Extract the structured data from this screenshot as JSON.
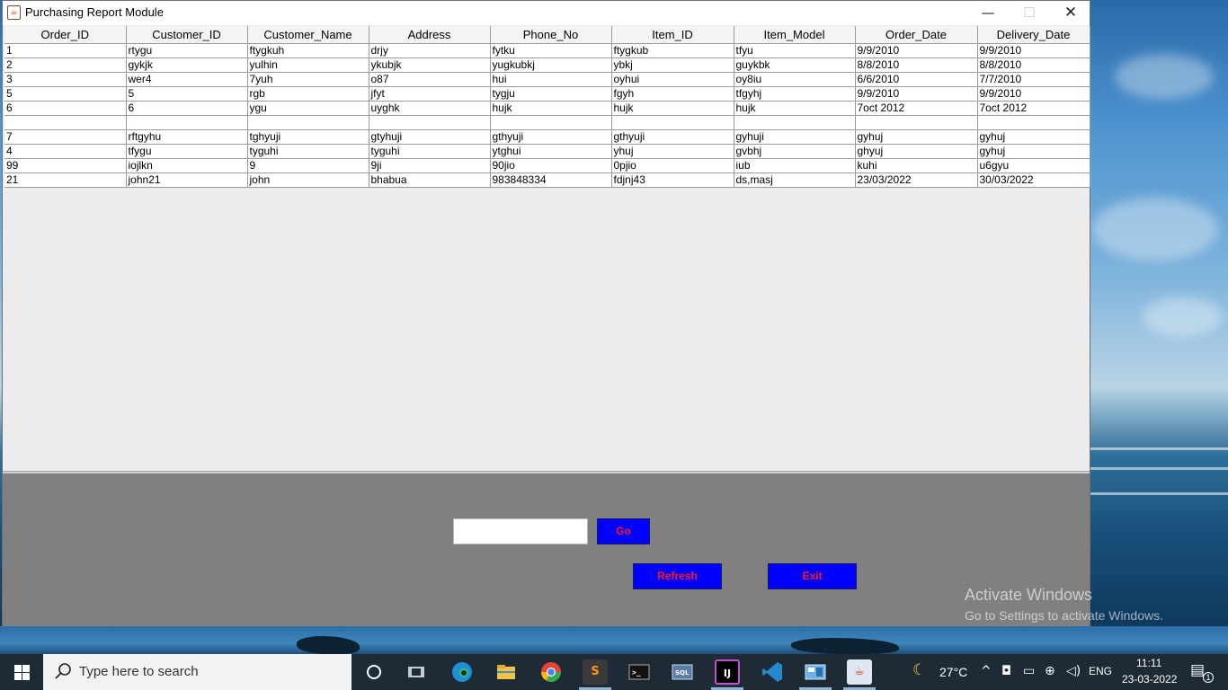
{
  "window": {
    "title": "Purchasing Report Module",
    "app_icon": "java-coffee-icon",
    "controls": {
      "minimize": "—",
      "maximize": "☐",
      "close": "✕"
    }
  },
  "table": {
    "columns": [
      "Order_ID",
      "Customer_ID",
      "Customer_Name",
      "Address",
      "Phone_No",
      "Item_ID",
      "Item_Model",
      "Order_Date",
      "Delivery_Date"
    ],
    "rows": [
      [
        "1",
        "rtygu",
        "ftygkuh",
        "drjy",
        "fytku",
        "ftygkub",
        "tfyu",
        "9/9/2010",
        "9/9/2010"
      ],
      [
        "2",
        "gykjk",
        "yulhin",
        "ykubjk",
        "yugkubkj",
        "ybkj",
        "guykbk",
        "8/8/2010",
        "8/8/2010"
      ],
      [
        "3",
        "wer4",
        "7yuh",
        "o87",
        "hui",
        "oyhui",
        "oy8iu",
        "6/6/2010",
        "7/7/2010"
      ],
      [
        "5",
        "5",
        "rgb",
        "jfyt",
        "tygju",
        "fgyh",
        "tfgyhj",
        "9/9/2010",
        "9/9/2010"
      ],
      [
        "6",
        "6",
        "ygu",
        "uyghk",
        "hujk",
        "hujk",
        "hujk",
        "7oct 2012",
        "7oct 2012"
      ],
      [
        "",
        "",
        "",
        "",
        "",
        "",
        "",
        "",
        ""
      ],
      [
        "7",
        "rftgyhu",
        "tghyuji",
        "gtyhuji",
        "gthyuji",
        "gthyuji",
        "gyhuji",
        "gyhuj",
        "gyhuj"
      ],
      [
        "4",
        "tfygu",
        "tyguhi",
        "tyguhi",
        "ytghui",
        "yhuj",
        "gvbhj",
        "ghyuj",
        "gyhuj"
      ],
      [
        "99",
        "iojlkn",
        "9",
        "9ji",
        "90jio",
        "0pjio",
        "iub",
        "kuhi",
        "u6gyu"
      ],
      [
        "21",
        "john21",
        "john",
        "bhabua",
        "983848334",
        "fdjnj43",
        "ds,masj",
        "23/03/2022",
        "30/03/2022"
      ]
    ]
  },
  "controls": {
    "search_value": "",
    "go_label": "Go",
    "refresh_label": "Refresh",
    "exit_label": "Exit",
    "button_bg": "#0000ff",
    "button_text_color": "#ff1a1a",
    "panel_bg": "#808080"
  },
  "watermark": {
    "title": "Activate Windows",
    "subtitle": "Go to Settings to activate Windows."
  },
  "taskbar": {
    "search_placeholder": "Type here to search",
    "pinned": [
      "cortana-icon",
      "task-view-icon",
      "edge-icon",
      "file-explorer-icon",
      "chrome-icon",
      "sublime-text-icon",
      "terminal-icon",
      "sql-icon",
      "intellij-icon",
      "vscode-icon",
      "control-panel-icon",
      "java-icon"
    ],
    "weather": {
      "icon": "moon-cloud-icon",
      "temperature": "27°C"
    },
    "language": "ENG",
    "time": "11:11",
    "date": "23-03-2022",
    "notification_count": "1"
  }
}
